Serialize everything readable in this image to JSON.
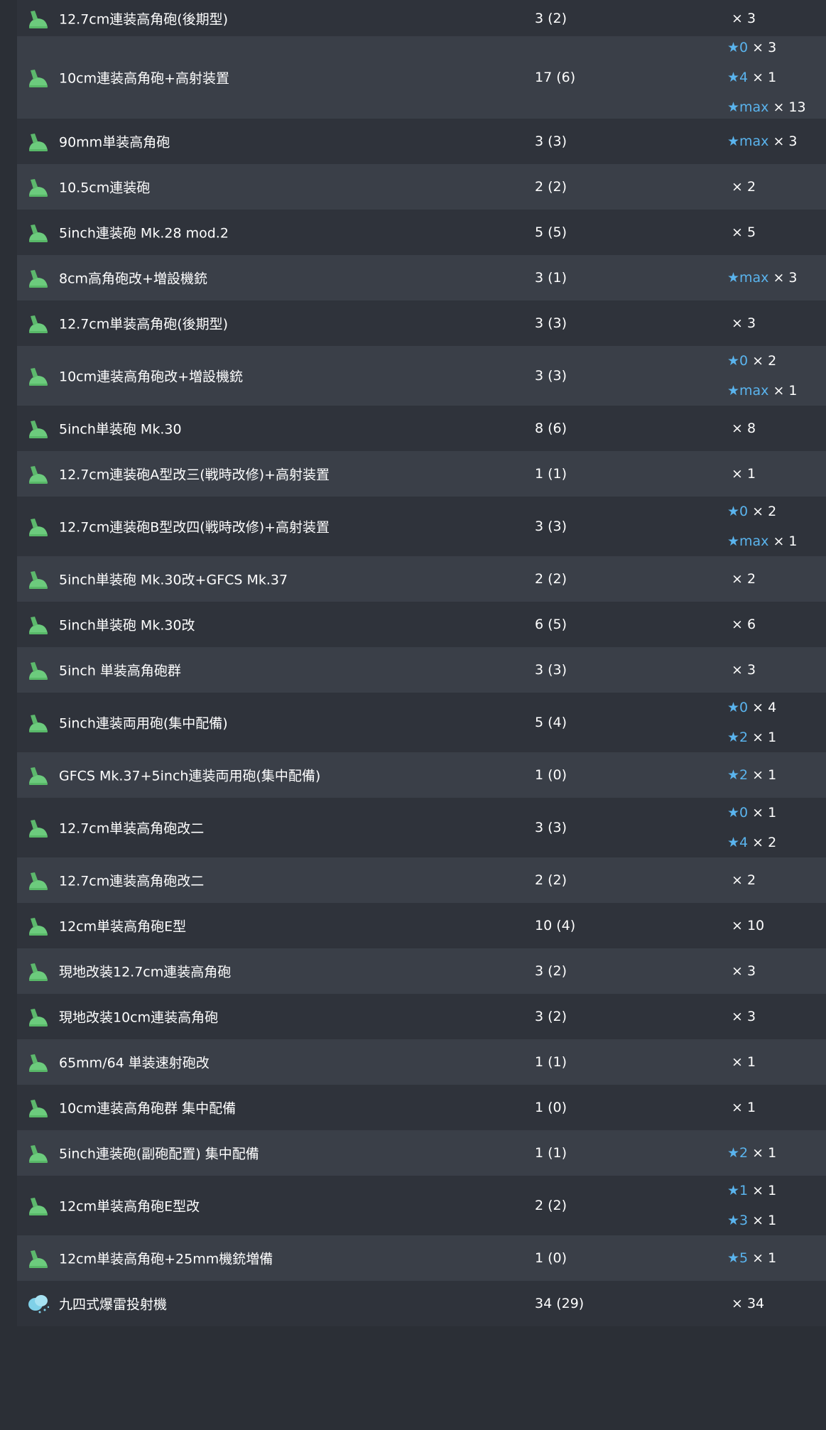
{
  "colors": {
    "star": "#5ab4ee",
    "row_dark": "#2f333b",
    "row_light": "#3a3f48",
    "icon_green": "#6ccb7d",
    "icon_torpedo": "#7fd0e8"
  },
  "rows": [
    {
      "icon": "gun-icon",
      "name": "12.7cm連装高角砲(後期型)",
      "count": "3 (2)",
      "levels": [
        {
          "star": "",
          "qty": "× 3"
        }
      ]
    },
    {
      "icon": "gun-icon",
      "name": "10cm連装高角砲+高射装置",
      "count": "17 (6)",
      "levels": [
        {
          "star": "★0",
          "qty": "× 3"
        },
        {
          "star": "★4",
          "qty": "× 1"
        },
        {
          "star": "★max",
          "qty": "× 13"
        }
      ]
    },
    {
      "icon": "gun-icon",
      "name": "90mm単装高角砲",
      "count": "3 (3)",
      "levels": [
        {
          "star": "★max",
          "qty": "× 3"
        }
      ]
    },
    {
      "icon": "gun-icon",
      "name": "10.5cm連装砲",
      "count": "2 (2)",
      "levels": [
        {
          "star": "",
          "qty": "× 2"
        }
      ]
    },
    {
      "icon": "gun-icon",
      "name": "5inch連装砲 Mk.28 mod.2",
      "count": "5 (5)",
      "levels": [
        {
          "star": "",
          "qty": "× 5"
        }
      ]
    },
    {
      "icon": "gun-icon",
      "name": "8cm高角砲改+増設機銃",
      "count": "3 (1)",
      "levels": [
        {
          "star": "★max",
          "qty": "× 3"
        }
      ]
    },
    {
      "icon": "gun-icon",
      "name": "12.7cm単装高角砲(後期型)",
      "count": "3 (3)",
      "levels": [
        {
          "star": "",
          "qty": "× 3"
        }
      ]
    },
    {
      "icon": "gun-icon",
      "name": "10cm連装高角砲改+増設機銃",
      "count": "3 (3)",
      "levels": [
        {
          "star": "★0",
          "qty": "× 2"
        },
        {
          "star": "★max",
          "qty": "× 1"
        }
      ]
    },
    {
      "icon": "gun-icon",
      "name": "5inch単装砲 Mk.30",
      "count": "8 (6)",
      "levels": [
        {
          "star": "",
          "qty": "× 8"
        }
      ]
    },
    {
      "icon": "gun-icon",
      "name": "12.7cm連装砲A型改三(戦時改修)+高射装置",
      "count": "1 (1)",
      "levels": [
        {
          "star": "",
          "qty": "× 1"
        }
      ]
    },
    {
      "icon": "gun-icon",
      "name": "12.7cm連装砲B型改四(戦時改修)+高射装置",
      "count": "3 (3)",
      "levels": [
        {
          "star": "★0",
          "qty": "× 2"
        },
        {
          "star": "★max",
          "qty": "× 1"
        }
      ]
    },
    {
      "icon": "gun-icon",
      "name": "5inch単装砲 Mk.30改+GFCS Mk.37",
      "count": "2 (2)",
      "levels": [
        {
          "star": "",
          "qty": "× 2"
        }
      ]
    },
    {
      "icon": "gun-icon",
      "name": "5inch単装砲 Mk.30改",
      "count": "6 (5)",
      "levels": [
        {
          "star": "",
          "qty": "× 6"
        }
      ]
    },
    {
      "icon": "gun-icon",
      "name": "5inch 単装高角砲群",
      "count": "3 (3)",
      "levels": [
        {
          "star": "",
          "qty": "× 3"
        }
      ]
    },
    {
      "icon": "gun-icon",
      "name": "5inch連装両用砲(集中配備)",
      "count": "5 (4)",
      "levels": [
        {
          "star": "★0",
          "qty": "× 4"
        },
        {
          "star": "★2",
          "qty": "× 1"
        }
      ]
    },
    {
      "icon": "gun-icon",
      "name": "GFCS Mk.37+5inch連装両用砲(集中配備)",
      "count": "1 (0)",
      "levels": [
        {
          "star": "★2",
          "qty": "× 1"
        }
      ]
    },
    {
      "icon": "gun-icon",
      "name": "12.7cm単装高角砲改二",
      "count": "3 (3)",
      "levels": [
        {
          "star": "★0",
          "qty": "× 1"
        },
        {
          "star": "★4",
          "qty": "× 2"
        }
      ]
    },
    {
      "icon": "gun-icon",
      "name": "12.7cm連装高角砲改二",
      "count": "2 (2)",
      "levels": [
        {
          "star": "",
          "qty": "× 2"
        }
      ]
    },
    {
      "icon": "gun-icon",
      "name": "12cm単装高角砲E型",
      "count": "10 (4)",
      "levels": [
        {
          "star": "",
          "qty": "× 10"
        }
      ]
    },
    {
      "icon": "gun-icon",
      "name": "現地改装12.7cm連装高角砲",
      "count": "3 (2)",
      "levels": [
        {
          "star": "",
          "qty": "× 3"
        }
      ]
    },
    {
      "icon": "gun-icon",
      "name": "現地改装10cm連装高角砲",
      "count": "3 (2)",
      "levels": [
        {
          "star": "",
          "qty": "× 3"
        }
      ]
    },
    {
      "icon": "gun-icon",
      "name": "65mm/64 単装速射砲改",
      "count": "1 (1)",
      "levels": [
        {
          "star": "",
          "qty": "× 1"
        }
      ]
    },
    {
      "icon": "gun-icon",
      "name": "10cm連装高角砲群 集中配備",
      "count": "1 (0)",
      "levels": [
        {
          "star": "",
          "qty": "× 1"
        }
      ]
    },
    {
      "icon": "gun-icon",
      "name": "5inch連装砲(副砲配置) 集中配備",
      "count": "1 (1)",
      "levels": [
        {
          "star": "★2",
          "qty": "× 1"
        }
      ]
    },
    {
      "icon": "gun-icon",
      "name": "12cm単装高角砲E型改",
      "count": "2 (2)",
      "levels": [
        {
          "star": "★1",
          "qty": "× 1"
        },
        {
          "star": "★3",
          "qty": "× 1"
        }
      ]
    },
    {
      "icon": "gun-icon",
      "name": "12cm単装高角砲+25mm機銃増備",
      "count": "1 (0)",
      "levels": [
        {
          "star": "★5",
          "qty": "× 1"
        }
      ]
    },
    {
      "icon": "depth-charge-projector-icon",
      "name": "九四式爆雷投射機",
      "count": "34 (29)",
      "levels": [
        {
          "star": "",
          "qty": "× 34"
        }
      ]
    }
  ]
}
